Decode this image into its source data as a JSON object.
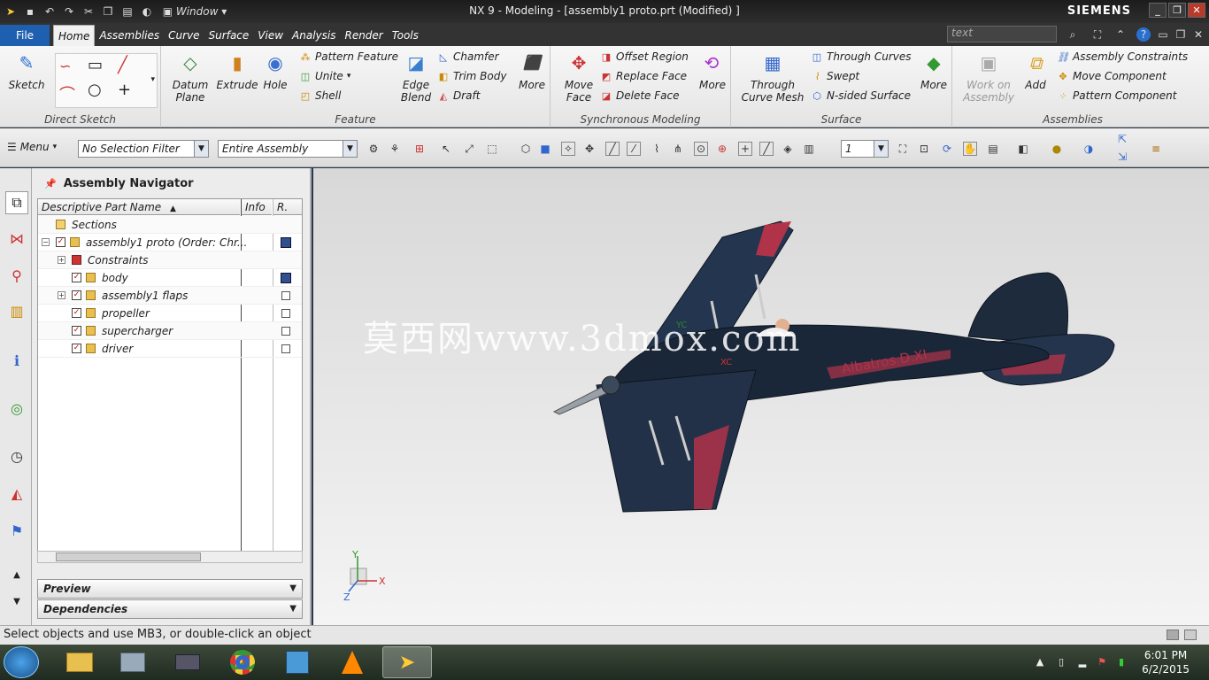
{
  "window": {
    "title": "NX 9 - Modeling - [assembly1 proto.prt (Modified) ]",
    "brand": "SIEMENS",
    "min": "_",
    "max": "❐",
    "close": "✕"
  },
  "tabs": {
    "file": "File",
    "items": [
      "Home",
      "Assemblies",
      "Curve",
      "Surface",
      "View",
      "Analysis",
      "Render",
      "Tools"
    ],
    "active": "Home",
    "search_placeholder": "text"
  },
  "ribbon": {
    "direct_sketch": {
      "label": "Direct Sketch",
      "sketch": "Sketch"
    },
    "feature": {
      "label": "Feature",
      "datum_plane": "Datum\nPlane",
      "extrude": "Extrude",
      "hole": "Hole",
      "pattern_feature": "Pattern Feature",
      "unite": "Unite",
      "shell": "Shell",
      "edge_blend": "Edge\nBlend",
      "chamfer": "Chamfer",
      "trim_body": "Trim Body",
      "draft": "Draft",
      "more": "More"
    },
    "sync": {
      "label": "Synchronous Modeling",
      "move_face": "Move\nFace",
      "offset_region": "Offset Region",
      "replace_face": "Replace Face",
      "delete_face": "Delete Face",
      "more": "More"
    },
    "surface": {
      "label": "Surface",
      "through_curve_mesh": "Through\nCurve Mesh",
      "through_curves": "Through Curves",
      "swept": "Swept",
      "n_sided": "N-sided Surface",
      "more": "More"
    },
    "assemblies": {
      "label": "Assemblies",
      "work_on": "Work on\nAssembly",
      "add": "Add",
      "constraints": "Assembly Constraints",
      "move_component": "Move Component",
      "pattern_component": "Pattern Component"
    }
  },
  "selbar": {
    "menu": "Menu",
    "filter": "No Selection Filter",
    "scope": "Entire Assembly",
    "layer": "1"
  },
  "navigator": {
    "title": "Assembly Navigator",
    "columns": [
      "Descriptive Part Name",
      "Info",
      "R."
    ],
    "rows": [
      {
        "name": "Sections",
        "indent": 0,
        "type": "folder"
      },
      {
        "name": "assembly1 proto (Order: Chr...",
        "indent": 0,
        "type": "assembly",
        "checked": true,
        "saved": true
      },
      {
        "name": "Constraints",
        "indent": 1,
        "type": "constraints"
      },
      {
        "name": "body",
        "indent": 1,
        "type": "part",
        "checked": true,
        "saved": true
      },
      {
        "name": "assembly1 flaps",
        "indent": 1,
        "type": "assembly",
        "checked": true
      },
      {
        "name": "propeller",
        "indent": 1,
        "type": "part",
        "checked": true
      },
      {
        "name": "supercharger",
        "indent": 1,
        "type": "part",
        "checked": true
      },
      {
        "name": "driver",
        "indent": 1,
        "type": "part",
        "checked": true
      }
    ],
    "preview": "Preview",
    "dependencies": "Dependencies"
  },
  "viewport": {
    "watermark": "莫西网www.3dmox.com",
    "plane_label": "Albatros D.XI",
    "triad": {
      "x": "X",
      "y": "Y",
      "z": "Z"
    },
    "wcs": {
      "yc": "YC",
      "xc": "XC"
    }
  },
  "status": "Select objects and use MB3, or double-click an object",
  "taskbar": {
    "time": "6:01 PM",
    "date": "6/2/2015"
  }
}
